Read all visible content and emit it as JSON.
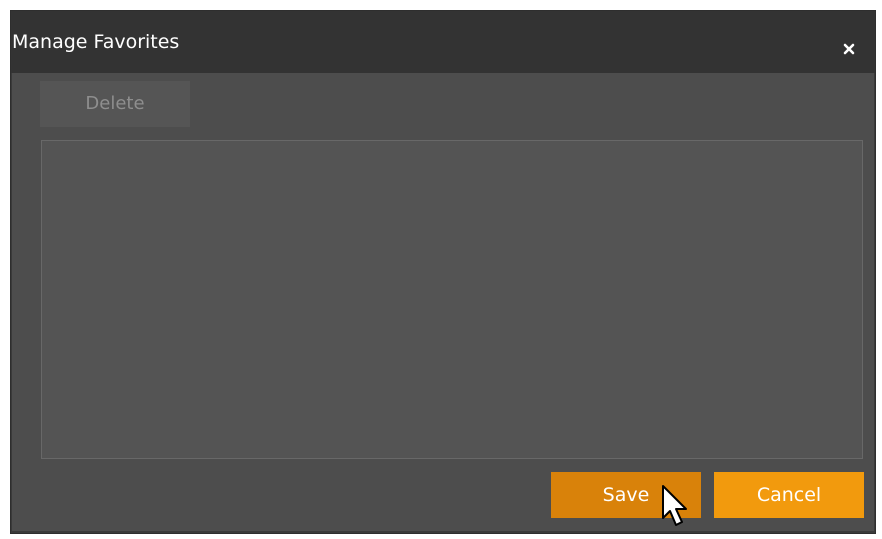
{
  "dialog": {
    "title": "Manage Favorites",
    "close_icon": "close-icon"
  },
  "toolbar": {
    "delete_label": "Delete"
  },
  "favorites_list": {
    "items": []
  },
  "footer": {
    "save_label": "Save",
    "cancel_label": "Cancel"
  },
  "colors": {
    "accent_primary": "#d9820a",
    "accent_secondary": "#f29a0d",
    "dialog_background": "#4d4d4d",
    "titlebar_background": "#333333"
  }
}
